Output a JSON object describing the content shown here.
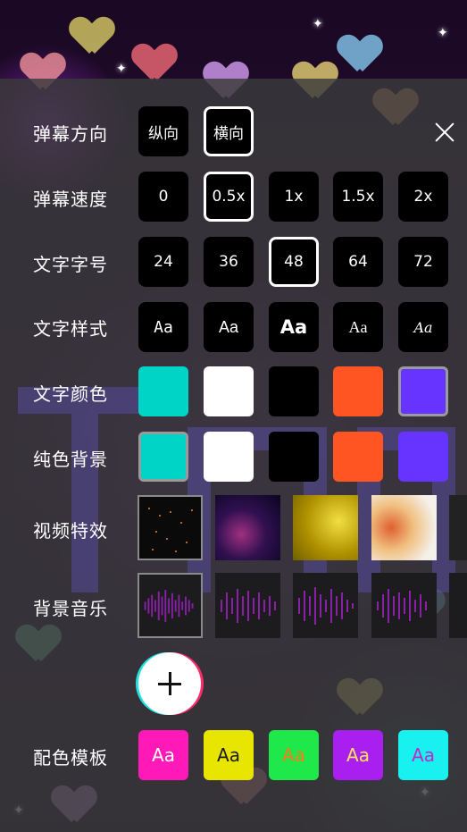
{
  "panel": {
    "labels": {
      "direction": "弹幕方向",
      "speed": "弹幕速度",
      "size": "文字字号",
      "style": "文字样式",
      "color": "文字颜色",
      "bg": "纯色背景",
      "video": "视频特效",
      "music": "背景音乐",
      "template": "配色模板"
    },
    "direction_options": [
      "纵向",
      "横向"
    ],
    "direction_selected": "横向",
    "speed_options": [
      "0",
      "0.5x",
      "1x",
      "1.5x",
      "2x"
    ],
    "speed_selected": "0.5x",
    "size_options": [
      "24",
      "36",
      "48",
      "64",
      "72"
    ],
    "size_selected": "48",
    "style_options": [
      "Aa",
      "Aa",
      "Aa",
      "Aa",
      "Aa"
    ],
    "text_colors": [
      "#00d4c6",
      "#ffffff",
      "#000000",
      "#ff5522",
      "#6633ff"
    ],
    "text_color_selected": "#6633ff",
    "bg_colors": [
      "#00d4c6",
      "#ffffff",
      "#000000",
      "#ff5522",
      "#6633ff"
    ],
    "bg_color_selected": "#00d4c6",
    "templates": [
      {
        "label": "Aa",
        "bg": "#ff19b8",
        "fg": "#ffffff"
      },
      {
        "label": "Aa",
        "bg": "#e8e600",
        "fg": "#1a1a1a"
      },
      {
        "label": "Aa",
        "bg": "#1fe84a",
        "fg": "#ff7a1a"
      },
      {
        "label": "Aa",
        "bg": "#a81ff0",
        "fg": "#ffe15a"
      },
      {
        "label": "Aa",
        "bg": "#19f0f0",
        "fg": "#c028c8"
      }
    ],
    "icons": {
      "close": "close-icon",
      "add": "plus-icon"
    }
  }
}
